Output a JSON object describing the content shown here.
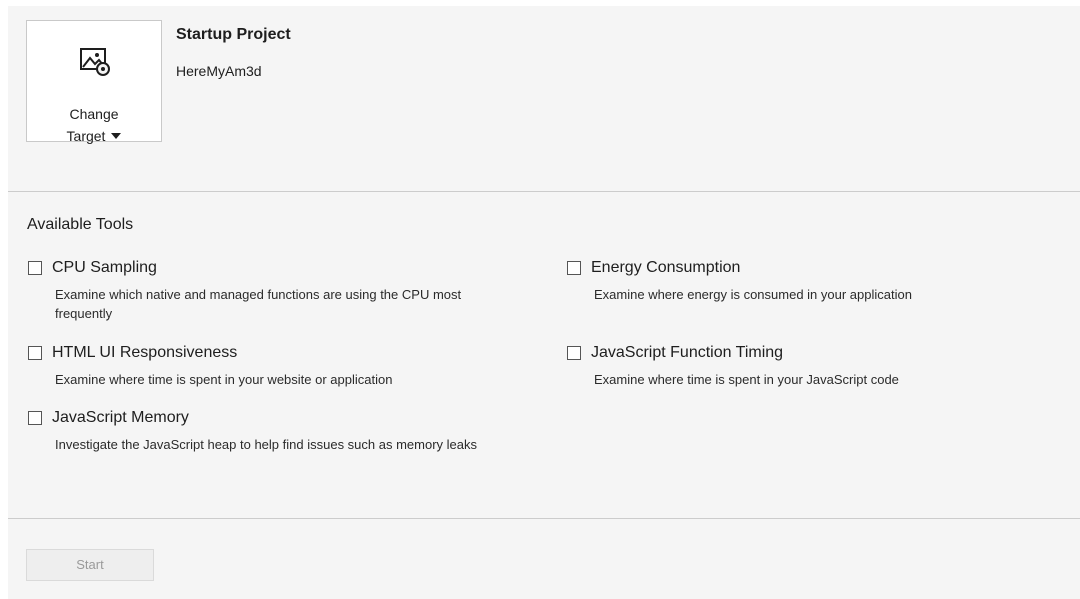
{
  "target": {
    "icon": "image-settings-icon",
    "label_line1": "Change",
    "label_line2": "Target"
  },
  "startup": {
    "title": "Startup Project",
    "value": "HereMyAm3d"
  },
  "tools": {
    "title": "Available Tools",
    "items": [
      {
        "name": "CPU Sampling",
        "desc": "Examine which native and managed functions are using the CPU most frequently",
        "checked": false
      },
      {
        "name": "Energy Consumption",
        "desc": "Examine where energy is consumed in your application",
        "checked": false
      },
      {
        "name": "HTML UI Responsiveness",
        "desc": "Examine where time is spent in your website or application",
        "checked": false
      },
      {
        "name": "JavaScript Function Timing",
        "desc": "Examine where time is spent in your JavaScript code",
        "checked": false
      },
      {
        "name": "JavaScript Memory",
        "desc": "Investigate the JavaScript heap to help find issues such as memory leaks",
        "checked": false
      }
    ]
  },
  "footer": {
    "start_label": "Start",
    "start_enabled": false
  }
}
